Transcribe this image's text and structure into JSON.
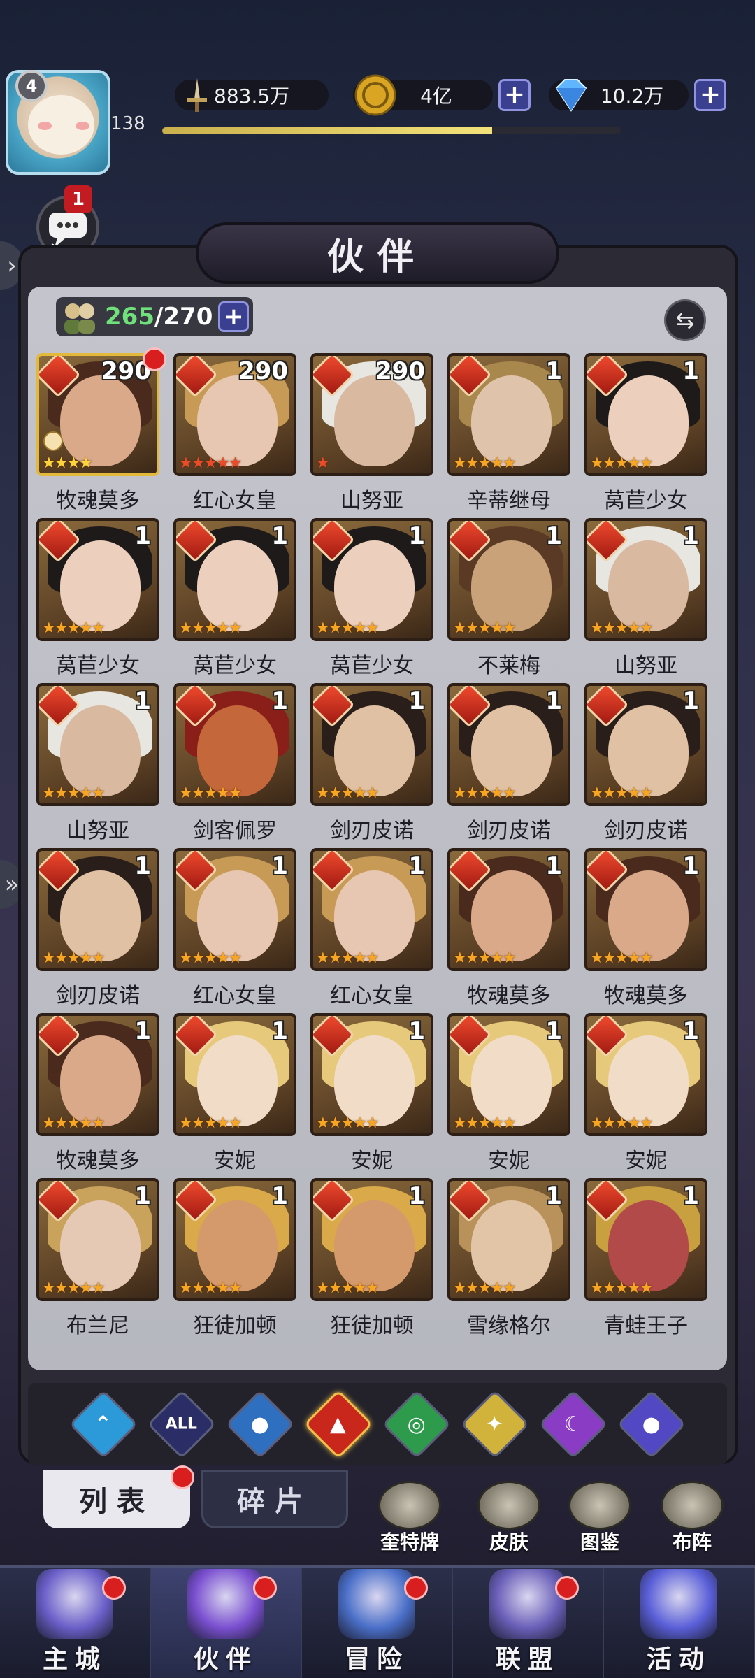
{
  "player": {
    "level_badge": "4",
    "level_num": "138",
    "xp_progress": 0.72
  },
  "resources": {
    "power": "883.5万",
    "gold": "4亿",
    "gems": "10.2万",
    "plus_label": "+"
  },
  "chat": {
    "label": "聊天",
    "badge": "1"
  },
  "panel": {
    "title": "伙伴",
    "count_current": "265",
    "count_max": "/270",
    "plus_label": "+",
    "swap_icon": "⇆"
  },
  "heroes": [
    {
      "name": "牧魂莫多",
      "level": "290",
      "stars": "★★★★",
      "star_color": "yellow",
      "gold_frame": true,
      "red_dot": true,
      "hair": "#4a2a1c",
      "skin": "#d9a98a"
    },
    {
      "name": "红心女皇",
      "level": "290",
      "stars": "★★★★★",
      "star_color": "red",
      "gold_frame": false,
      "red_dot": false,
      "hair": "#c79a56",
      "skin": "#e8c7b2"
    },
    {
      "name": "山努亚",
      "level": "290",
      "stars": "★",
      "star_color": "red",
      "gold_frame": false,
      "red_dot": false,
      "hair": "#e8e6e0",
      "skin": "#d9b9a0"
    },
    {
      "name": "辛蒂继母",
      "level": "1",
      "stars": "★★★★★",
      "star_color": "orange",
      "gold_frame": false,
      "red_dot": false,
      "hair": "#a8884c",
      "skin": "#e0c3ab"
    },
    {
      "name": "莴苣少女",
      "level": "1",
      "stars": "★★★★★",
      "star_color": "orange",
      "gold_frame": false,
      "red_dot": false,
      "hair": "#1e1a1a",
      "skin": "#ecd0bd"
    },
    {
      "name": "莴苣少女",
      "level": "1",
      "stars": "★★★★★",
      "star_color": "orange",
      "gold_frame": false,
      "red_dot": false,
      "hair": "#1e1a1a",
      "skin": "#ecd0bd"
    },
    {
      "name": "莴苣少女",
      "level": "1",
      "stars": "★★★★★",
      "star_color": "orange",
      "gold_frame": false,
      "red_dot": false,
      "hair": "#1e1a1a",
      "skin": "#ecd0bd"
    },
    {
      "name": "莴苣少女",
      "level": "1",
      "stars": "★★★★★",
      "star_color": "orange",
      "gold_frame": false,
      "red_dot": false,
      "hair": "#1e1a1a",
      "skin": "#ecd0bd"
    },
    {
      "name": "不莱梅",
      "level": "1",
      "stars": "★★★★★",
      "star_color": "orange",
      "gold_frame": false,
      "red_dot": false,
      "hair": "#5a3a24",
      "skin": "#c9a27a"
    },
    {
      "name": "山努亚",
      "level": "1",
      "stars": "★★★★★",
      "star_color": "orange",
      "gold_frame": false,
      "red_dot": false,
      "hair": "#e8e6e0",
      "skin": "#d9b9a0"
    },
    {
      "name": "山努亚",
      "level": "1",
      "stars": "★★★★★",
      "star_color": "orange",
      "gold_frame": false,
      "red_dot": false,
      "hair": "#e8e6e0",
      "skin": "#d9b9a0"
    },
    {
      "name": "剑客佩罗",
      "level": "1",
      "stars": "★★★★★",
      "star_color": "orange",
      "gold_frame": false,
      "red_dot": false,
      "hair": "#8a1f1a",
      "skin": "#c4673a"
    },
    {
      "name": "剑刃皮诺",
      "level": "1",
      "stars": "★★★★★",
      "star_color": "orange",
      "gold_frame": false,
      "red_dot": false,
      "hair": "#2a1e1a",
      "skin": "#e1c1a4"
    },
    {
      "name": "剑刃皮诺",
      "level": "1",
      "stars": "★★★★★",
      "star_color": "orange",
      "gold_frame": false,
      "red_dot": false,
      "hair": "#2a1e1a",
      "skin": "#e1c1a4"
    },
    {
      "name": "剑刃皮诺",
      "level": "1",
      "stars": "★★★★★",
      "star_color": "orange",
      "gold_frame": false,
      "red_dot": false,
      "hair": "#2a1e1a",
      "skin": "#e1c1a4"
    },
    {
      "name": "剑刃皮诺",
      "level": "1",
      "stars": "★★★★★",
      "star_color": "orange",
      "gold_frame": false,
      "red_dot": false,
      "hair": "#2a1e1a",
      "skin": "#e1c1a4"
    },
    {
      "name": "红心女皇",
      "level": "1",
      "stars": "★★★★★",
      "star_color": "orange",
      "gold_frame": false,
      "red_dot": false,
      "hair": "#c79a56",
      "skin": "#e8c7b2"
    },
    {
      "name": "红心女皇",
      "level": "1",
      "stars": "★★★★★",
      "star_color": "orange",
      "gold_frame": false,
      "red_dot": false,
      "hair": "#c79a56",
      "skin": "#e8c7b2"
    },
    {
      "name": "牧魂莫多",
      "level": "1",
      "stars": "★★★★★",
      "star_color": "orange",
      "gold_frame": false,
      "red_dot": false,
      "hair": "#4a2a1c",
      "skin": "#d9a98a"
    },
    {
      "name": "牧魂莫多",
      "level": "1",
      "stars": "★★★★★",
      "star_color": "orange",
      "gold_frame": false,
      "red_dot": false,
      "hair": "#4a2a1c",
      "skin": "#d9a98a"
    },
    {
      "name": "牧魂莫多",
      "level": "1",
      "stars": "★★★★★",
      "star_color": "orange",
      "gold_frame": false,
      "red_dot": false,
      "hair": "#4a2a1c",
      "skin": "#d9a98a"
    },
    {
      "name": "安妮",
      "level": "1",
      "stars": "★★★★★",
      "star_color": "orange",
      "gold_frame": false,
      "red_dot": false,
      "hair": "#e6c97a",
      "skin": "#f1dcc8"
    },
    {
      "name": "安妮",
      "level": "1",
      "stars": "★★★★★",
      "star_color": "orange",
      "gold_frame": false,
      "red_dot": false,
      "hair": "#e6c97a",
      "skin": "#f1dcc8"
    },
    {
      "name": "安妮",
      "level": "1",
      "stars": "★★★★★",
      "star_color": "orange",
      "gold_frame": false,
      "red_dot": false,
      "hair": "#e6c97a",
      "skin": "#f1dcc8"
    },
    {
      "name": "安妮",
      "level": "1",
      "stars": "★★★★★",
      "star_color": "orange",
      "gold_frame": false,
      "red_dot": false,
      "hair": "#e6c97a",
      "skin": "#f1dcc8"
    },
    {
      "name": "布兰尼",
      "level": "1",
      "stars": "★★★★★",
      "star_color": "orange",
      "gold_frame": false,
      "red_dot": false,
      "hair": "#c9a25c",
      "skin": "#e5c9b4"
    },
    {
      "name": "狂徒加顿",
      "level": "1",
      "stars": "★★★★★",
      "star_color": "orange",
      "gold_frame": false,
      "red_dot": false,
      "hair": "#d9a94a",
      "skin": "#d49a6c"
    },
    {
      "name": "狂徒加顿",
      "level": "1",
      "stars": "★★★★★",
      "star_color": "orange",
      "gold_frame": false,
      "red_dot": false,
      "hair": "#d9a94a",
      "skin": "#d49a6c"
    },
    {
      "name": "雪缘格尔",
      "level": "1",
      "stars": "★★★★★",
      "star_color": "orange",
      "gold_frame": false,
      "red_dot": false,
      "hair": "#b8925a",
      "skin": "#e2c4a6"
    },
    {
      "name": "青蛙王子",
      "level": "1",
      "stars": "★★★★★",
      "star_color": "orange",
      "gold_frame": false,
      "red_dot": false,
      "hair": "#c8a040",
      "skin": "#b24a4a"
    }
  ],
  "filters": [
    {
      "icon": "up-chevron-icon",
      "glyph": "⌃",
      "color": "#2c9ad8"
    },
    {
      "icon": "all-filter-icon",
      "glyph": "ALL",
      "color": "#2b2e66"
    },
    {
      "icon": "water-drop-icon",
      "glyph": "●",
      "color": "#2f6fc0"
    },
    {
      "icon": "fire-icon",
      "glyph": "▲",
      "color": "#c9271c"
    },
    {
      "icon": "wind-icon",
      "glyph": "◎",
      "color": "#2e9b4c"
    },
    {
      "icon": "light-star-icon",
      "glyph": "✦",
      "color": "#d1b23a"
    },
    {
      "icon": "moon-icon",
      "glyph": "☾",
      "color": "#8a3cc4"
    },
    {
      "icon": "planet-icon",
      "glyph": "●",
      "color": "#5248c4"
    }
  ],
  "subtabs": {
    "list_label": "列表",
    "shards_label": "碎片"
  },
  "shortcuts": [
    {
      "label": "奎特牌",
      "icon": "tarot-card-icon"
    },
    {
      "label": "皮肤",
      "icon": "skin-outfit-icon"
    },
    {
      "label": "图鉴",
      "icon": "codex-book-icon"
    },
    {
      "label": "布阵",
      "icon": "formation-chess-icon"
    }
  ],
  "nav": [
    {
      "label": "主城",
      "icon": "castle-icon",
      "dot": true,
      "color": "#6a5fc8"
    },
    {
      "label": "伙伴",
      "icon": "wizard-hat-icon",
      "dot": true,
      "color": "#7a4fd0"
    },
    {
      "label": "冒险",
      "icon": "compass-star-icon",
      "dot": true,
      "color": "#4a6fc8"
    },
    {
      "label": "联盟",
      "icon": "shield-crest-icon",
      "dot": true,
      "color": "#6a5fb8"
    },
    {
      "label": "活动",
      "icon": "cards-icon",
      "dot": false,
      "color": "#5a5fd8"
    }
  ]
}
